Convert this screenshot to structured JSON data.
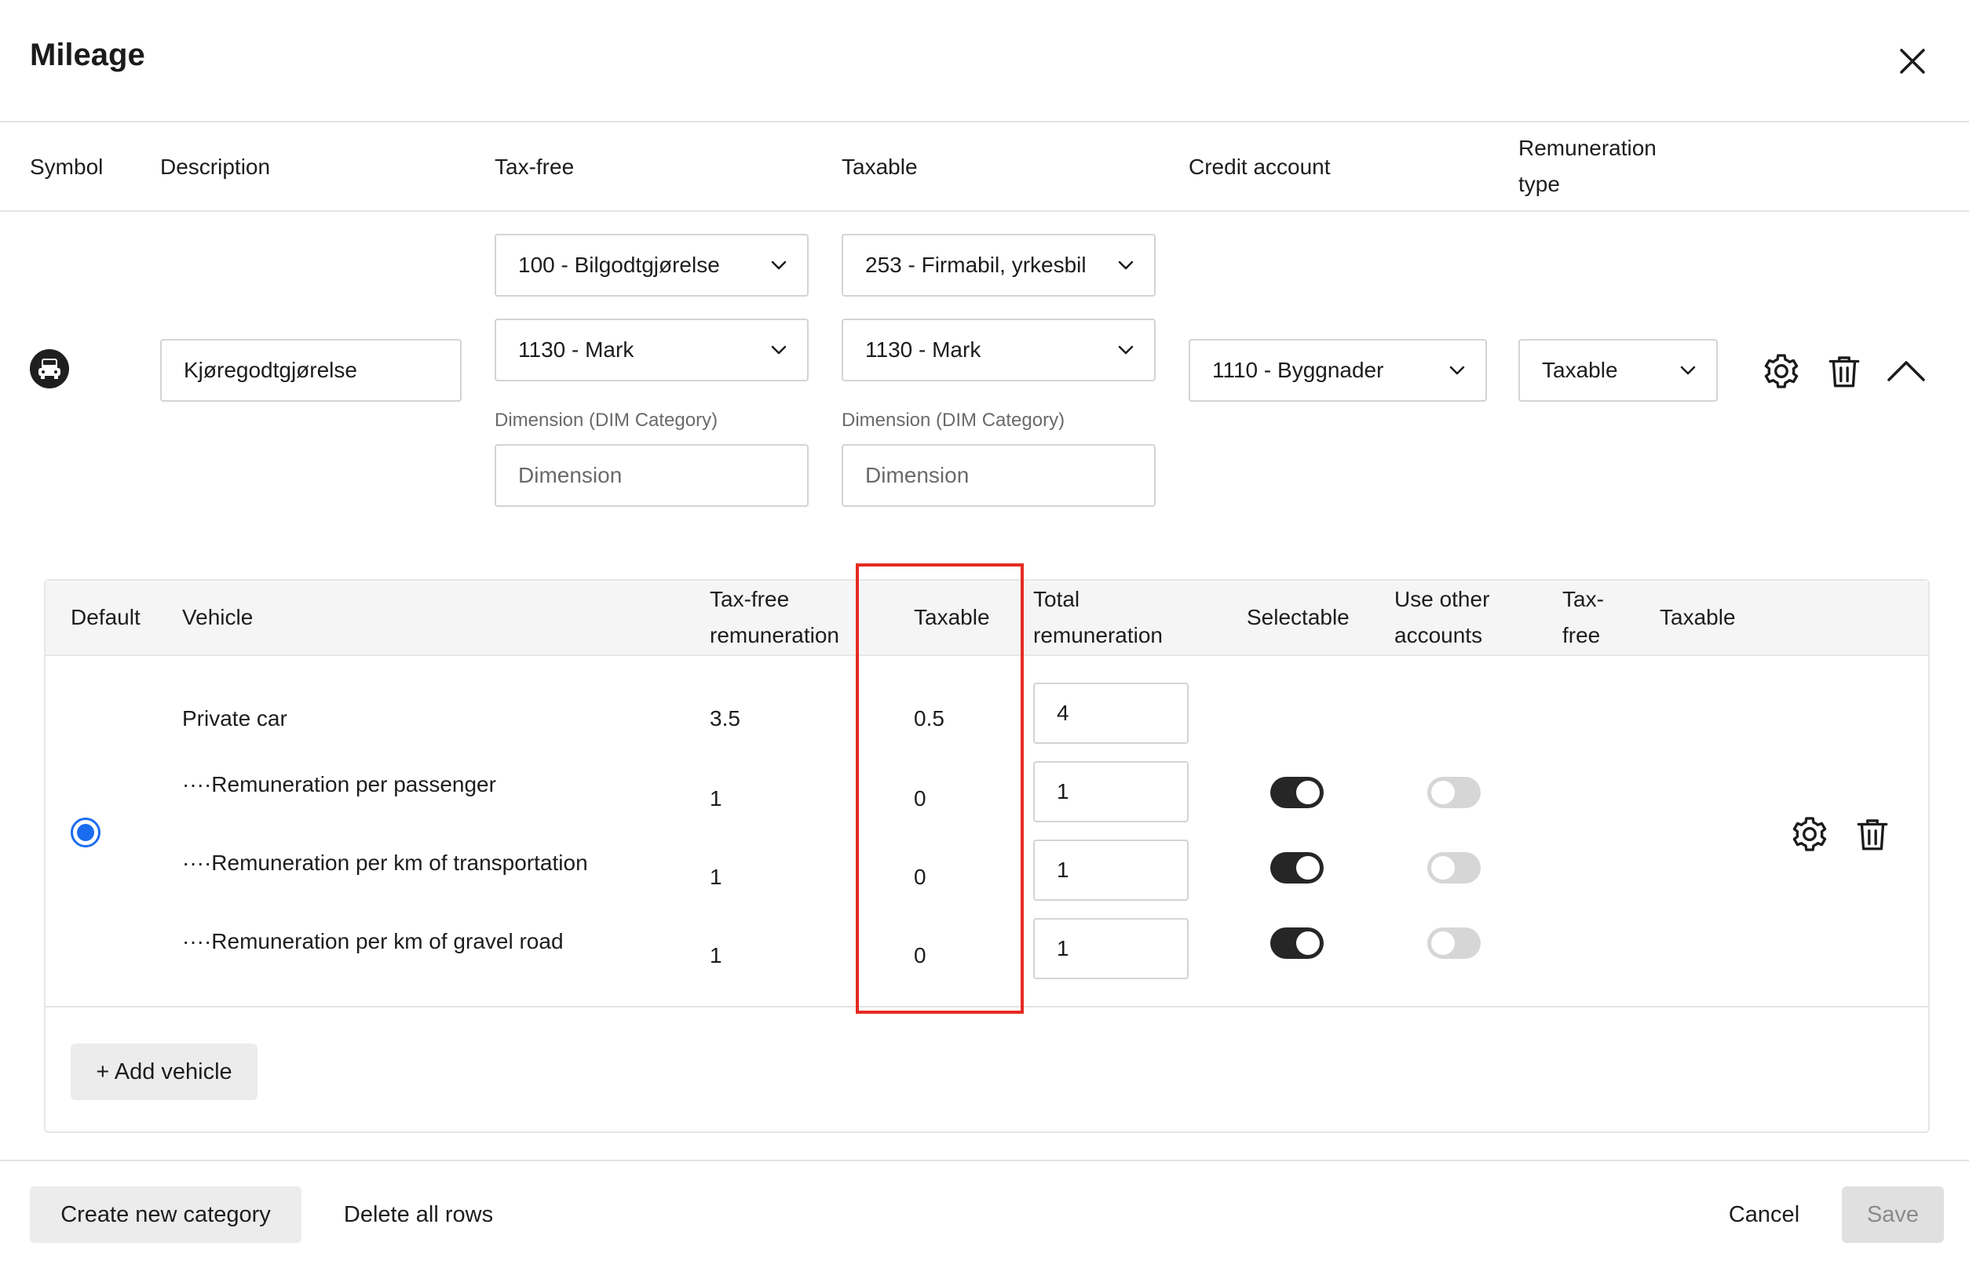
{
  "dialog": {
    "title": "Mileage"
  },
  "columns": {
    "symbol": "Symbol",
    "description": "Description",
    "tax_free": "Tax-free",
    "taxable": "Taxable",
    "credit_account": "Credit account",
    "remuneration_type_line1": "Remuneration",
    "remuneration_type_line2": "type"
  },
  "row": {
    "symbol_icon": "car-icon",
    "description_value": "Kjøregodtgjørelse",
    "tax_free_code": "100 - Bilgodtgjørelse",
    "tax_free_account": "1130 - Mark",
    "taxable_code": "253 - Firmabil, yrkesbil",
    "taxable_account": "1130 - Mark",
    "dimension_label": "Dimension (DIM Category)",
    "dimension_placeholder": "Dimension",
    "credit_account_value": "1110 - Byggnader",
    "remuneration_type_value": "Taxable"
  },
  "vehicle_table": {
    "headers": {
      "default": "Default",
      "vehicle": "Vehicle",
      "tax_free_remuneration_1": "Tax-free",
      "tax_free_remuneration_2": "remuneration",
      "taxable": "Taxable",
      "total_remuneration_1": "Total",
      "total_remuneration_2": "remuneration",
      "selectable": "Selectable",
      "use_other_accounts_1": "Use other",
      "use_other_accounts_2": "accounts",
      "tax_free_1": "Tax-",
      "tax_free_2": "free",
      "taxable2": "Taxable"
    },
    "default_selected": true,
    "rows": [
      {
        "vehicle": "Private car",
        "tax_free": "3.5",
        "taxable": "0.5",
        "total": "4"
      },
      {
        "vehicle": "····Remuneration per passenger",
        "tax_free": "1",
        "taxable": "0",
        "total": "1",
        "selectable": true,
        "use_other_accounts": false
      },
      {
        "vehicle": "····Remuneration per km of transportation",
        "tax_free": "1",
        "taxable": "0",
        "total": "1",
        "selectable": true,
        "use_other_accounts": false
      },
      {
        "vehicle": "····Remuneration per km of gravel road",
        "tax_free": "1",
        "taxable": "0",
        "total": "1",
        "selectable": true,
        "use_other_accounts": false
      }
    ],
    "add_vehicle_label": "+ Add vehicle"
  },
  "footer": {
    "create_category_label": "Create new category",
    "delete_rows_label": "Delete all rows",
    "cancel_label": "Cancel",
    "save_label": "Save"
  },
  "colors": {
    "accent": "#1a6cf0",
    "highlight": "#e52b22",
    "toggle_on": "#262626",
    "toggle_off": "#d6d6d6"
  }
}
